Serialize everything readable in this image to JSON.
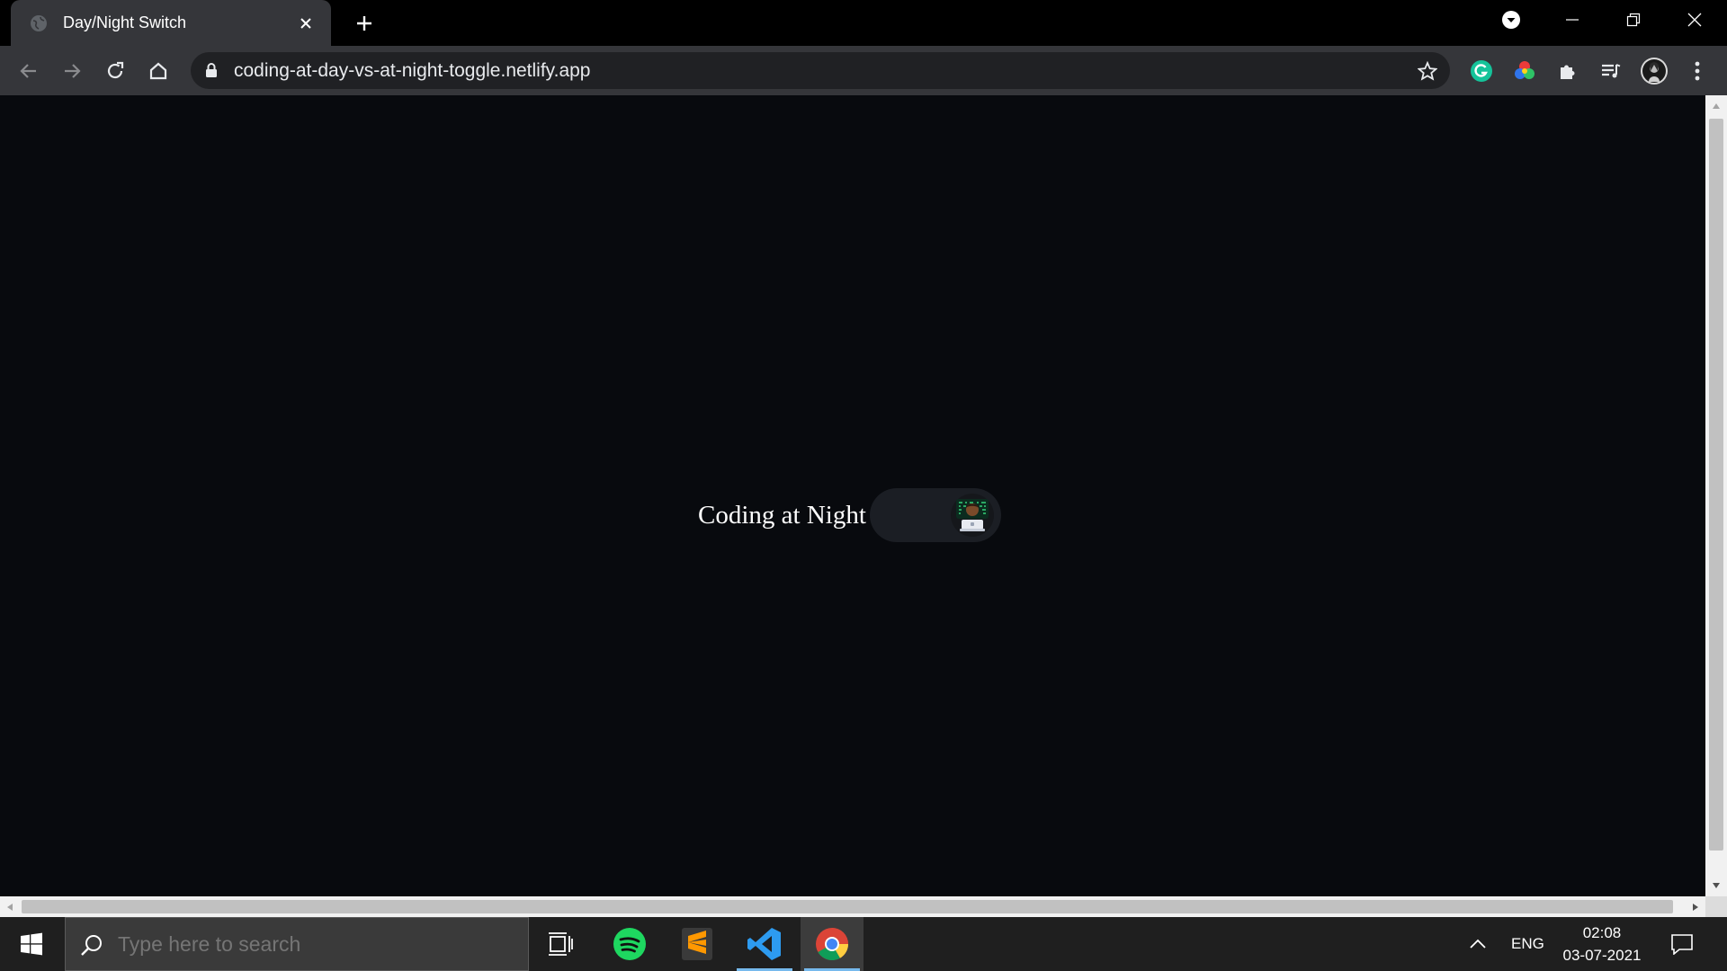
{
  "browser": {
    "tab": {
      "title": "Day/Night Switch"
    },
    "address_bar": {
      "url": "coding-at-day-vs-at-night-toggle.netlify.app"
    }
  },
  "page": {
    "mode_label": "Coding at Night",
    "toggle": {
      "state": "night",
      "emoji": "🧑🏾‍💻"
    },
    "colors": {
      "background": "#080a0e",
      "switch_track": "#1b1e24",
      "text": "#ffffff"
    }
  },
  "taskbar": {
    "search_placeholder": "Type here to search",
    "language": "ENG",
    "time": "02:08",
    "date": "03-07-2021"
  }
}
